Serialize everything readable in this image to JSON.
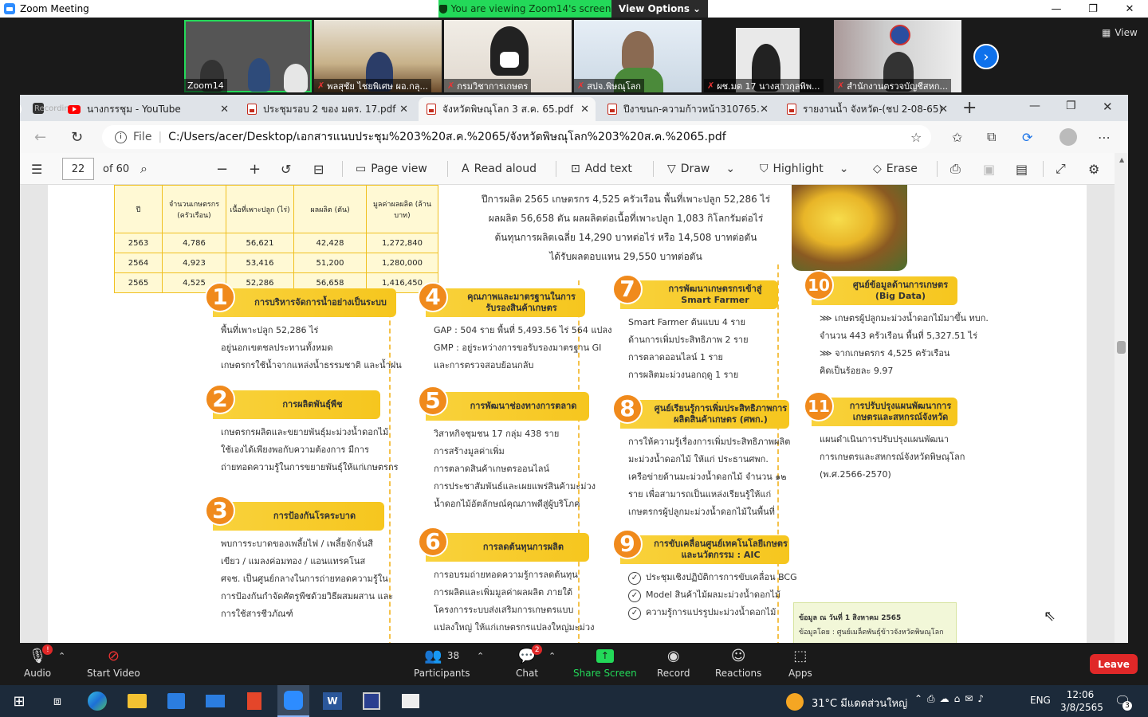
{
  "zoom": {
    "window_title": "Zoom Meeting",
    "banner": "You are viewing Zoom14's screen",
    "view_options": "View Options",
    "gallery_view": "View",
    "participants": [
      {
        "name": "Zoom14",
        "muted": false
      },
      {
        "name": "พลสุชัย ไชยพิเศษ ผอ.กลุ...",
        "muted": true
      },
      {
        "name": "กรมวิชาการเกษตร",
        "muted": true
      },
      {
        "name": "สปจ.พิษณุโลก",
        "muted": true
      },
      {
        "name": "ผช.มต 17 นางสาวกุลพิพ...",
        "muted": true
      },
      {
        "name": "สำนักงานตรวจบัญชีสหก...",
        "muted": true
      }
    ],
    "toolbar": {
      "audio": "Audio",
      "start_video": "Start Video",
      "participants": "Participants",
      "participants_count": "38",
      "chat": "Chat",
      "chat_badge": "2",
      "share": "Share Screen",
      "record": "Record",
      "reactions": "Reactions",
      "apps": "Apps",
      "leave": "Leave",
      "audio_badge": "!"
    }
  },
  "browser": {
    "recording": "Recording",
    "tabs": [
      {
        "label": "นางกรรชุม - YouTube",
        "active": false
      },
      {
        "label": "ประชุมรอบ 2 ของ มตร. 17.pdf",
        "active": false
      },
      {
        "label": "จังหวัดพิษณุโลก 3 ส.ค. 65.pdf",
        "active": true
      },
      {
        "label": "ปีงาขนก-ความก้าวหน้า310765.",
        "active": false
      },
      {
        "label": "รายงานน้ำ จังหวัด-(ชป 2-08-65)",
        "active": false
      }
    ],
    "file_label": "File",
    "url": "C:/Users/acer/Desktop/เอกสารแนบประชุม%203%20ส.ค.%2065/จังหวัดพิษณุโลก%203%20ส.ค.%2065.pdf",
    "pdf": {
      "page": "22",
      "of": "of 60",
      "page_view": "Page view",
      "read_aloud": "Read aloud",
      "add_text": "Add text",
      "draw": "Draw",
      "highlight": "Highlight",
      "erase": "Erase"
    }
  },
  "infographic": {
    "table": {
      "headers": [
        "ปี",
        "จำนวนเกษตรกร (ครัวเรือน)",
        "เนื้อที่เพาะปลูก (ไร่)",
        "ผลผลิต (ตัน)",
        "มูลค่าผลผลิต (ล้านบาท)"
      ],
      "rows": [
        [
          "2563",
          "4,786",
          "56,621",
          "42,428",
          "1,272,840"
        ],
        [
          "2564",
          "4,923",
          "53,416",
          "51,200",
          "1,280,000"
        ],
        [
          "2565",
          "4,525",
          "52,286",
          "56,658",
          "1,416,450"
        ]
      ]
    },
    "summary": [
      "ปีการผลิต 2565 เกษตรกร 4,525 ครัวเรือน พื้นที่เพาะปลูก 52,286 ไร่",
      "ผลผลิต 56,658 ตัน ผลผลิตต่อเนื้อที่เพาะปลูก 1,083 กิโลกรัมต่อไร่",
      "ต้นทุนการผลิตเฉลี่ย 14,290 บาทต่อไร่ หรือ 14,508 บาทต่อตัน",
      "ได้รับผลตอบแทน 29,550 บาทต่อตัน"
    ],
    "sections": [
      {
        "n": "1",
        "title": "การบริหารจัดการน้ำอย่างเป็นระบบ",
        "lines": [
          "พื้นที่เพาะปลูก 52,286 ไร่",
          "อยู่นอกเขตชลประทานทั้งหมด",
          "เกษตรกรใช้น้ำจากแหล่งน้ำธรรมชาติ และน้ำฝน"
        ]
      },
      {
        "n": "2",
        "title": "การผลิตพันธุ์พืช",
        "lines": [
          "เกษตรกรผลิตและขยายพันธุ์มะม่วงน้ำดอกไม้",
          "ใช้เองได้เพียงพอกับความต้องการ มีการ",
          "ถ่ายทอดความรู้ในการขยายพันธุ์ให้แก่เกษตรกร"
        ]
      },
      {
        "n": "3",
        "title": "การป้องกันโรคระบาด",
        "lines": [
          "พบการระบาดของเพลี้ยไฟ / เพลี้ยจักจั่นสี",
          "เขียว / แมลงค่อมทอง / แอนแทรคโนส",
          "ศจช. เป็นศูนย์กลางในการถ่ายทอดความรู้ใน",
          "การป้องกันกำจัดศัตรูพืชด้วยวิธีผสมผสาน และ",
          "การใช้สารชีวภัณฑ์"
        ]
      },
      {
        "n": "4",
        "title": "คุณภาพและมาตรฐานในการรับรองสินค้าเกษตร",
        "lines": [
          "GAP : 504 ราย พื้นที่ 5,493.56 ไร่ 564 แปลง",
          "GMP : อยู่ระหว่างการขอรับรองมาตรฐาน GI",
          "และการตรวจสอบย้อนกลับ"
        ]
      },
      {
        "n": "5",
        "title": "การพัฒนาช่องทางการตลาด",
        "lines": [
          "วิสาหกิจชุมชน 17 กลุ่ม 438 ราย",
          "การสร้างมูลค่าเพิ่ม",
          "การตลาดสินค้าเกษตรออนไลน์",
          "การประชาสัมพันธ์และเผยแพร่สินค้ามะม่วง",
          "น้ำดอกไม้อัตลักษณ์คุณภาพดีสู่ผู้บริโภค"
        ]
      },
      {
        "n": "6",
        "title": "การลดต้นทุนการผลิต",
        "lines": [
          "การอบรมถ่ายทอดความรู้การลดต้นทุน",
          "การผลิตและเพิ่มมูลค่าผลผลิต ภายใต้",
          "โครงการระบบส่งเสริมการเกษตรแบบ",
          "แปลงใหญ่ ให้แก่เกษตรกรแปลงใหญ่มะม่วง"
        ]
      },
      {
        "n": "7",
        "title": "การพัฒนาเกษตรกรเข้าสู่ Smart Farmer",
        "lines": [
          "Smart Farmer ต้นแบบ 4 ราย",
          "ด้านการเพิ่มประสิทธิภาพ 2 ราย",
          "การตลาดออนไลน์ 1 ราย",
          "การผลิตมะม่วงนอกฤดู 1 ราย"
        ]
      },
      {
        "n": "8",
        "title": "ศูนย์เรียนรู้การเพิ่มประสิทธิภาพการผลิตสินค้าเกษตร (ศพก.)",
        "lines": [
          "การให้ความรู้เรื่องการเพิ่มประสิทธิภาพผลิต",
          "มะม่วงน้ำดอกไม้ ให้แก่ ประธานศพก.",
          "เครือข่ายด้านมะม่วงน้ำดอกไม้ จำนวน ๑๒",
          "ราย เพื่อสามารถเป็นแหล่งเรียนรู้ให้แก่",
          "เกษตรกรผู้ปลูกมะม่วงน้ำดอกไม้ในพื้นที่"
        ]
      },
      {
        "n": "9",
        "title": "การขับเคลื่อนศูนย์เทคโนโลยีเกษตรและนวัตกรรม : AIC",
        "lines": [
          "ประชุมเชิงปฏิบัติการการขับเคลื่อน BCG",
          "Model สินค้าไม้ผลมะม่วงน้ำดอกไม้",
          "ความรู้การแปรรูปมะม่วงน้ำดอกไม้"
        ]
      },
      {
        "n": "10",
        "title": "ศูนย์ข้อมูลด้านการเกษตร (Big Data)",
        "lines": [
          "เกษตรผู้ปลูกมะม่วงน้ำดอกไม้มาขึ้น ทบก.",
          "จำนวน 443 ครัวเรือน พื้นที่ 5,327.51 ไร่",
          "จากเกษตรกร 4,525 ครัวเรือน",
          "คิดเป็นร้อยละ 9.97"
        ]
      },
      {
        "n": "11",
        "title": "การปรับปรุงแผนพัฒนาการเกษตรและสหกรณ์จังหวัด",
        "lines": [
          "แผนดำเนินการปรับปรุงแผนพัฒนา",
          "การเกษตรและสหกรณ์จังหวัดพิษณุโลก",
          "(พ.ศ.2566-2570)"
        ]
      }
    ],
    "note": [
      "ข้อมูล ณ วันที่ 1 สิงหาคม 2565",
      "ข้อมูลโดย : ศูนย์เมล็ดพันธุ์ข้าวจังหวัดพิษณุโลก"
    ]
  },
  "taskbar": {
    "weather": "31°C มีแดดส่วนใหญ่",
    "lang": "ENG",
    "time": "12:06",
    "date": "3/8/2565",
    "notif": "3"
  }
}
